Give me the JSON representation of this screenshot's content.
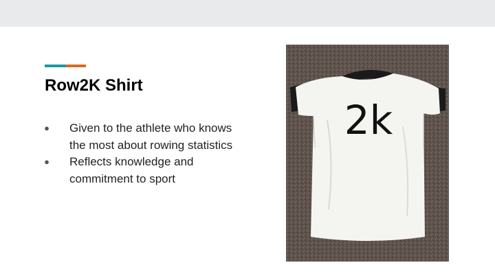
{
  "slide": {
    "title": "Row2K Shirt",
    "bullets": [
      "Given to the athlete who knows the most about rowing statistics",
      "Reflects knowledge and commitment to sport"
    ]
  },
  "photo": {
    "subject": "white-tshirt-with-2k-print",
    "shirt_print": "2k"
  },
  "colors": {
    "accent_teal": "#1b9aa3",
    "accent_orange": "#dd6a1f",
    "top_bar": "#e8eaeb",
    "carpet": "#5e524c"
  }
}
